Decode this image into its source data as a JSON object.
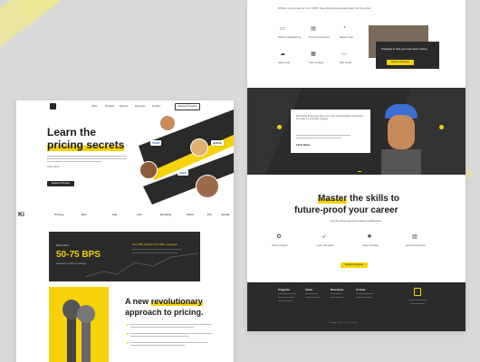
{
  "left": {
    "nav": {
      "items": [
        "Home",
        "Programs",
        "Reviews",
        "Resources",
        "Freebies"
      ],
      "cta": "Request Program"
    },
    "hero": {
      "title_l1": "Learn the",
      "title_l2": "pricing secrets",
      "sub": "The approach to pricing taught by leading companies at scale",
      "link": "Learn More",
      "cta": "Request Program"
    },
    "badges": [
      "TUCK",
      "Airbnb",
      "slack"
    ],
    "logos": [
      "Ki",
      "Pricing",
      "Moz",
      "Zap",
      "Lyft",
      "Booking",
      "Slack",
      "Pro",
      "Agoda"
    ],
    "stats": {
      "label": "Since 2011",
      "value": "50-75 BPS",
      "desc": "Increase in profit on average",
      "right_text": "Over 3000 students from 1000+ companies"
    },
    "revo": {
      "title_l1": "A new",
      "title_hl": "revolutionary",
      "title_l2": "approach to pricing."
    }
  },
  "right": {
    "intro": "Whether you're a team of 10 or 10,000, these pricing theories stand apart from the crowd",
    "features": [
      "Shared capital pricing",
      "Find new customers",
      "Market value",
      "Sales tools",
      "Team strategy",
      "Fast results"
    ],
    "promo": {
      "text": "Programs to help your team learn pricing",
      "cta": "Request Program"
    },
    "testimonial": {
      "quote": "Monetizing Pricing has been one of the most impactful investments we made in our growth strategy.",
      "name": "Client Name"
    },
    "master": {
      "hl": "Master",
      "l1": " the skills to",
      "l2": "future-proof your career",
      "desc": "Join the pricing programs trusted by global teams",
      "cta": "Request Program"
    },
    "steps": [
      "Pick a program",
      "Learn with peers",
      "Apply the ideas",
      "Grow the business"
    ],
    "footer": {
      "cols": [
        "Programs",
        "About",
        "Resources",
        "Contact"
      ],
      "copy": "Copyright 2024 - Pricing Partners"
    }
  },
  "colors": {
    "accent": "#f5d20a",
    "dark": "#262626"
  }
}
